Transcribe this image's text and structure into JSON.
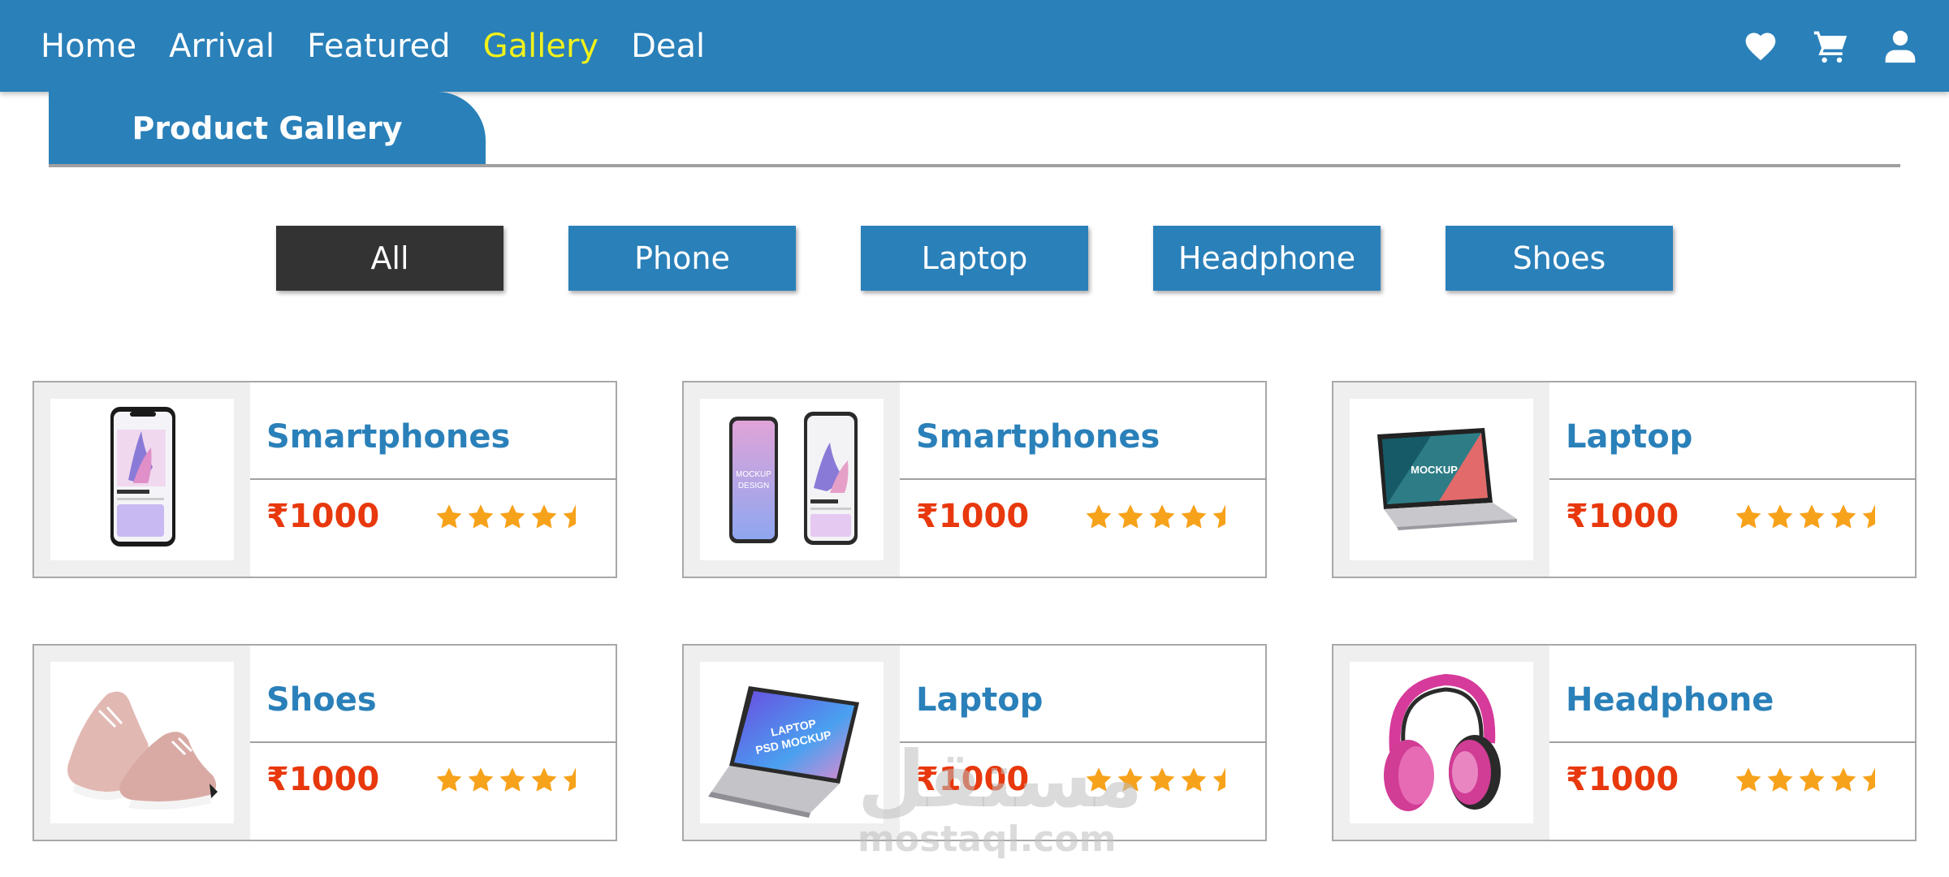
{
  "nav": {
    "links": [
      {
        "label": "Home",
        "active": false
      },
      {
        "label": "Arrival",
        "active": false
      },
      {
        "label": "Featured",
        "active": false
      },
      {
        "label": "Gallery",
        "active": true
      },
      {
        "label": "Deal",
        "active": false
      }
    ],
    "icons": [
      "heart-icon",
      "cart-icon",
      "user-icon"
    ]
  },
  "section": {
    "title": "Product Gallery"
  },
  "filters": [
    {
      "label": "All",
      "active": true
    },
    {
      "label": "Phone",
      "active": false
    },
    {
      "label": "Laptop",
      "active": false
    },
    {
      "label": "Headphone",
      "active": false
    },
    {
      "label": "Shoes",
      "active": false
    }
  ],
  "products": [
    {
      "title": "Smartphones",
      "price": "₹1000",
      "rating": 4.5,
      "image": "phone-image"
    },
    {
      "title": "Smartphones",
      "price": "₹1000",
      "rating": 4.5,
      "image": "phones-pair-image"
    },
    {
      "title": "Laptop",
      "price": "₹1000",
      "rating": 4.5,
      "image": "laptop-image"
    },
    {
      "title": "Shoes",
      "price": "₹1000",
      "rating": 4.5,
      "image": "shoes-image"
    },
    {
      "title": "Laptop",
      "price": "₹1000",
      "rating": 4.5,
      "image": "laptop-tilted-image"
    },
    {
      "title": "Headphone",
      "price": "₹1000",
      "rating": 4.5,
      "image": "headphone-image"
    }
  ],
  "watermark": {
    "arabic": "مستقل",
    "latin": "mostaql.com"
  },
  "colors": {
    "primary": "#2a80b9",
    "active_nav": "#f2f21a",
    "active_filter": "#333333",
    "price": "#e8380d",
    "star": "#f7a21b"
  }
}
